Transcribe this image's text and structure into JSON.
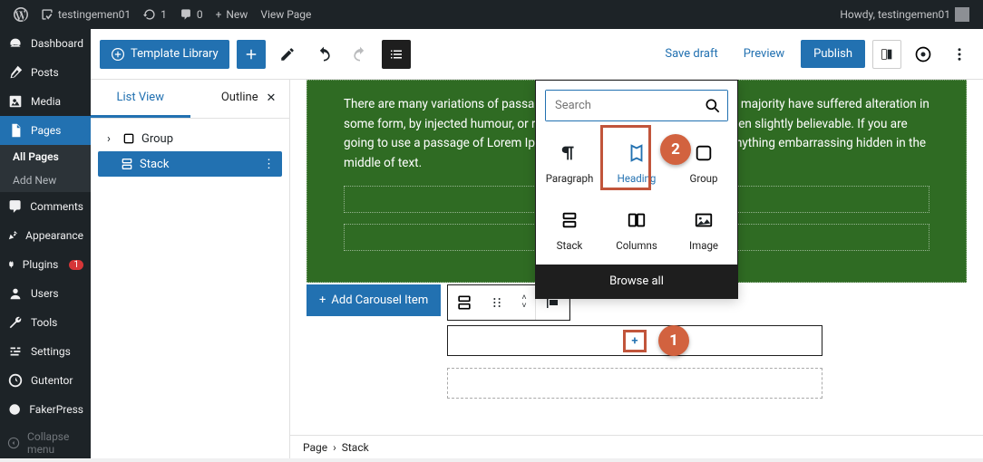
{
  "adminbar": {
    "site": "testingemen01",
    "updates": "1",
    "comments": "0",
    "new": "New",
    "view": "View Page",
    "howdy": "Howdy, testingemen01"
  },
  "sidebar": {
    "items": [
      {
        "label": "Dashboard"
      },
      {
        "label": "Posts"
      },
      {
        "label": "Media"
      },
      {
        "label": "Pages"
      },
      {
        "label": "Comments"
      },
      {
        "label": "Appearance"
      },
      {
        "label": "Plugins"
      },
      {
        "label": "Users"
      },
      {
        "label": "Tools"
      },
      {
        "label": "Settings"
      },
      {
        "label": "Gutentor"
      },
      {
        "label": "FakerPress"
      },
      {
        "label": "Collapse menu"
      }
    ],
    "submenu": {
      "all": "All Pages",
      "add": "Add New"
    },
    "plugin_badge": "1"
  },
  "toolbar": {
    "template_lib": "Template Library",
    "save": "Save draft",
    "preview": "Preview",
    "publish": "Publish"
  },
  "listview": {
    "tab_list": "List View",
    "tab_outline": "Outline",
    "tree": {
      "group": "Group",
      "stack": "Stack"
    }
  },
  "canvas": {
    "para": "There are many variations of passages of Lorem Ipsum available, but the majority have suffered alteration in some form, by injected humour, or randomised words which don't look even slightly believable. If you are going to use a passage of Lorem Ipsum, you need to be sure there isn't anything embarrassing hidden in the middle of text.",
    "add_carousel": "Add Carousel Item"
  },
  "inserter": {
    "search_placeholder": "Search",
    "items": [
      {
        "label": "Paragraph"
      },
      {
        "label": "Heading"
      },
      {
        "label": "Group"
      },
      {
        "label": "Stack"
      },
      {
        "label": "Columns"
      },
      {
        "label": "Image"
      }
    ],
    "browse": "Browse all"
  },
  "breadcrumb": {
    "page": "Page",
    "stack": "Stack"
  },
  "annotations": {
    "one": "1",
    "two": "2"
  }
}
